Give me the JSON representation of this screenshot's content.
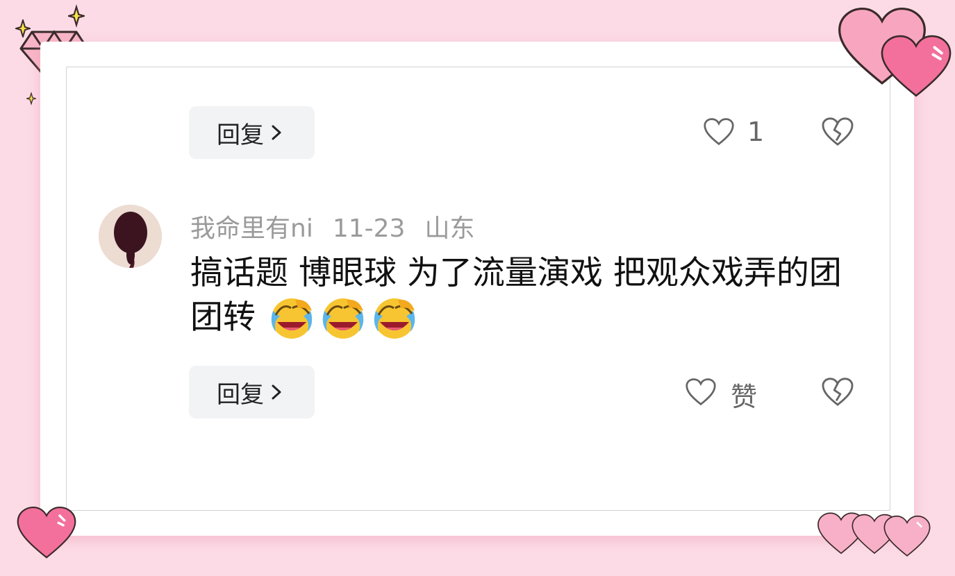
{
  "theme": {
    "background": "#fcdbe6",
    "heart_pink": "#f36a9a",
    "button_bg": "#f2f3f5"
  },
  "reply_top": {
    "label": "回复",
    "chevron_icon": "chevron-right-icon"
  },
  "like_top": {
    "icon": "heart-outline-icon",
    "count": "1"
  },
  "dislike_top": {
    "icon": "broken-heart-icon"
  },
  "comment": {
    "avatar": "avatar",
    "username": "我命里有ni",
    "date": "11-23",
    "location": "山东",
    "text": "搞话题 博眼球 为了流量演戏 把观众戏弄的团团转",
    "emojis": [
      "😭",
      "😭",
      "😭"
    ]
  },
  "reply_bottom": {
    "label": "回复",
    "chevron_icon": "chevron-right-icon"
  },
  "like_bottom": {
    "icon": "heart-outline-icon",
    "label": "赞"
  },
  "dislike_bottom": {
    "icon": "broken-heart-icon"
  },
  "decorations": [
    "diamond-icon",
    "sparkle-icon",
    "heart-icon"
  ]
}
